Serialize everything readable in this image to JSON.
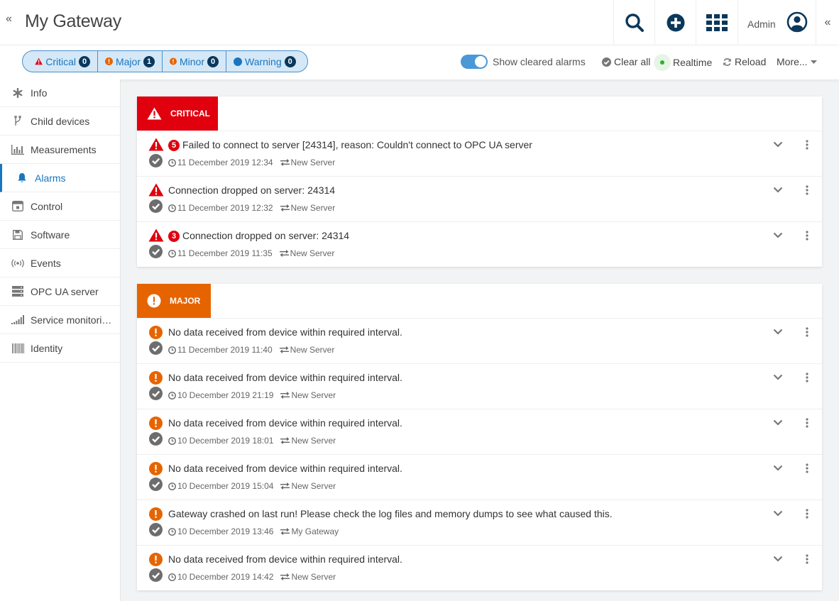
{
  "header": {
    "title": "My Gateway",
    "user_name": "Admin",
    "collapse_left_glyph": "«",
    "collapse_right_glyph": "«"
  },
  "filters": [
    {
      "label": "Critical",
      "count": "0",
      "color": "#e0000e",
      "icon": "critical-triangle-icon"
    },
    {
      "label": "Major",
      "count": "1",
      "color": "#e66400",
      "icon": "major-exclamation-icon"
    },
    {
      "label": "Minor",
      "count": "0",
      "color": "#e66400",
      "icon": "minor-exclamation-icon"
    },
    {
      "label": "Warning",
      "count": "0",
      "color": "#1776bf",
      "icon": "warning-circle-icon"
    }
  ],
  "toolbar": {
    "show_cleared_label": "Show cleared alarms",
    "show_cleared_on": true,
    "clear_all_label": "Clear all",
    "realtime_label": "Realtime",
    "reload_label": "Reload",
    "more_label": "More..."
  },
  "sidebar": {
    "items": [
      {
        "label": "Info",
        "icon": "asterisk-icon",
        "active": false
      },
      {
        "label": "Child devices",
        "icon": "branch-icon",
        "active": false
      },
      {
        "label": "Measurements",
        "icon": "bar-chart-icon",
        "active": false
      },
      {
        "label": "Alarms",
        "icon": "bell-icon",
        "active": true
      },
      {
        "label": "Control",
        "icon": "control-icon",
        "active": false
      },
      {
        "label": "Software",
        "icon": "floppy-icon",
        "active": false
      },
      {
        "label": "Events",
        "icon": "broadcast-icon",
        "active": false
      },
      {
        "label": "OPC UA server",
        "icon": "server-icon",
        "active": false
      },
      {
        "label": "Service monitoring",
        "icon": "signal-icon",
        "active": false
      },
      {
        "label": "Identity",
        "icon": "barcode-icon",
        "active": false
      }
    ]
  },
  "critical": {
    "label": "CRITICAL",
    "color": "#e0000e",
    "alarms": [
      {
        "count": "5",
        "message": "Failed to connect to server [24314], reason: Couldn't connect to OPC UA server",
        "time": "11 December 2019 12:34",
        "source": "New Server"
      },
      {
        "count": null,
        "message": "Connection dropped on server: 24314",
        "time": "11 December 2019 12:32",
        "source": "New Server"
      },
      {
        "count": "3",
        "message": "Connection dropped on server: 24314",
        "time": "11 December 2019 11:35",
        "source": "New Server"
      }
    ]
  },
  "major": {
    "label": "MAJOR",
    "color": "#e66400",
    "alarms": [
      {
        "count": null,
        "message": "No data received from device within required interval.",
        "time": "11 December 2019 11:40",
        "source": "New Server"
      },
      {
        "count": null,
        "message": "No data received from device within required interval.",
        "time": "10 December 2019 21:19",
        "source": "New Server"
      },
      {
        "count": null,
        "message": "No data received from device within required interval.",
        "time": "10 December 2019 18:01",
        "source": "New Server"
      },
      {
        "count": null,
        "message": "No data received from device within required interval.",
        "time": "10 December 2019 15:04",
        "source": "New Server"
      },
      {
        "count": null,
        "message": "Gateway crashed on last run! Please check the log files and memory dumps to see what caused this.",
        "time": "10 December 2019 13:46",
        "source": "My Gateway"
      },
      {
        "count": null,
        "message": "No data received from device within required interval.",
        "time": "10 December 2019 14:42",
        "source": "New Server"
      }
    ]
  }
}
